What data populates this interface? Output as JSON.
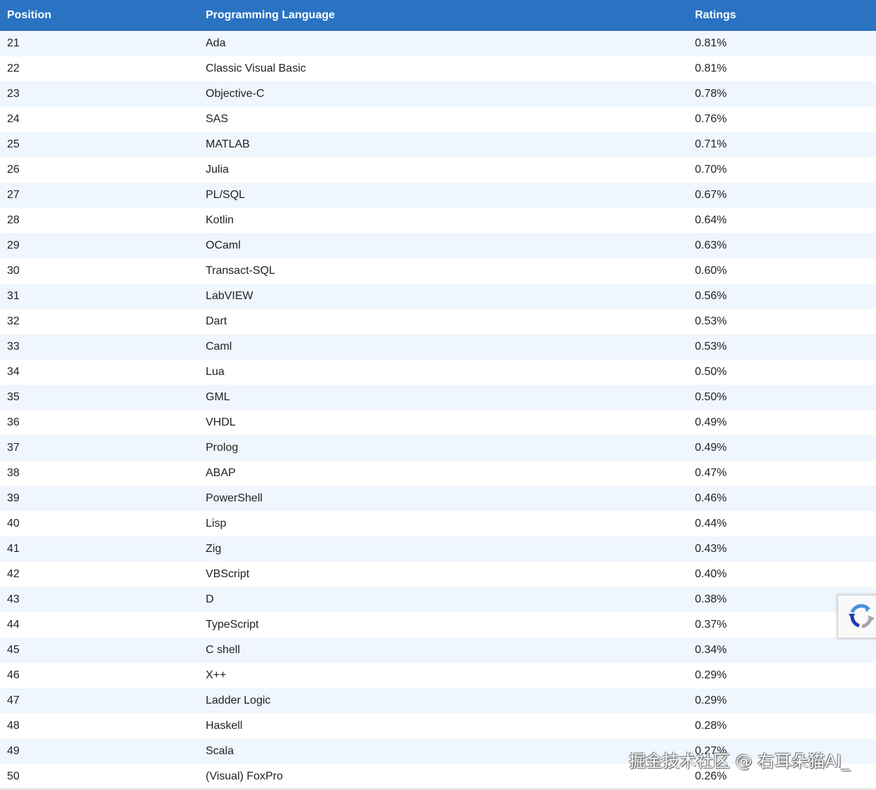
{
  "table": {
    "headers": {
      "position": "Position",
      "language": "Programming Language",
      "ratings": "Ratings"
    },
    "rows": [
      {
        "position": "21",
        "language": "Ada",
        "rating": "0.81%"
      },
      {
        "position": "22",
        "language": "Classic Visual Basic",
        "rating": "0.81%"
      },
      {
        "position": "23",
        "language": "Objective-C",
        "rating": "0.78%"
      },
      {
        "position": "24",
        "language": "SAS",
        "rating": "0.76%"
      },
      {
        "position": "25",
        "language": "MATLAB",
        "rating": "0.71%"
      },
      {
        "position": "26",
        "language": "Julia",
        "rating": "0.70%"
      },
      {
        "position": "27",
        "language": "PL/SQL",
        "rating": "0.67%"
      },
      {
        "position": "28",
        "language": "Kotlin",
        "rating": "0.64%"
      },
      {
        "position": "29",
        "language": "OCaml",
        "rating": "0.63%"
      },
      {
        "position": "30",
        "language": "Transact-SQL",
        "rating": "0.60%"
      },
      {
        "position": "31",
        "language": "LabVIEW",
        "rating": "0.56%"
      },
      {
        "position": "32",
        "language": "Dart",
        "rating": "0.53%"
      },
      {
        "position": "33",
        "language": "Caml",
        "rating": "0.53%"
      },
      {
        "position": "34",
        "language": "Lua",
        "rating": "0.50%"
      },
      {
        "position": "35",
        "language": "GML",
        "rating": "0.50%"
      },
      {
        "position": "36",
        "language": "VHDL",
        "rating": "0.49%"
      },
      {
        "position": "37",
        "language": "Prolog",
        "rating": "0.49%"
      },
      {
        "position": "38",
        "language": "ABAP",
        "rating": "0.47%"
      },
      {
        "position": "39",
        "language": "PowerShell",
        "rating": "0.46%"
      },
      {
        "position": "40",
        "language": "Lisp",
        "rating": "0.44%"
      },
      {
        "position": "41",
        "language": "Zig",
        "rating": "0.43%"
      },
      {
        "position": "42",
        "language": "VBScript",
        "rating": "0.40%"
      },
      {
        "position": "43",
        "language": "D",
        "rating": "0.38%"
      },
      {
        "position": "44",
        "language": "TypeScript",
        "rating": "0.37%"
      },
      {
        "position": "45",
        "language": "C shell",
        "rating": "0.34%"
      },
      {
        "position": "46",
        "language": "X++",
        "rating": "0.29%"
      },
      {
        "position": "47",
        "language": "Ladder Logic",
        "rating": "0.29%"
      },
      {
        "position": "48",
        "language": "Haskell",
        "rating": "0.28%"
      },
      {
        "position": "49",
        "language": "Scala",
        "rating": "0.27%"
      },
      {
        "position": "50",
        "language": "(Visual) FoxPro",
        "rating": "0.26%"
      }
    ]
  },
  "watermark": "掘金技术社区 @ 右耳朵猫AI_",
  "recaptcha": {
    "icon": "recaptcha-icon"
  },
  "colors": {
    "header_bg": "#2a73c2",
    "row_alt_bg": "#eff6fd",
    "row_bg": "#ffffff"
  }
}
